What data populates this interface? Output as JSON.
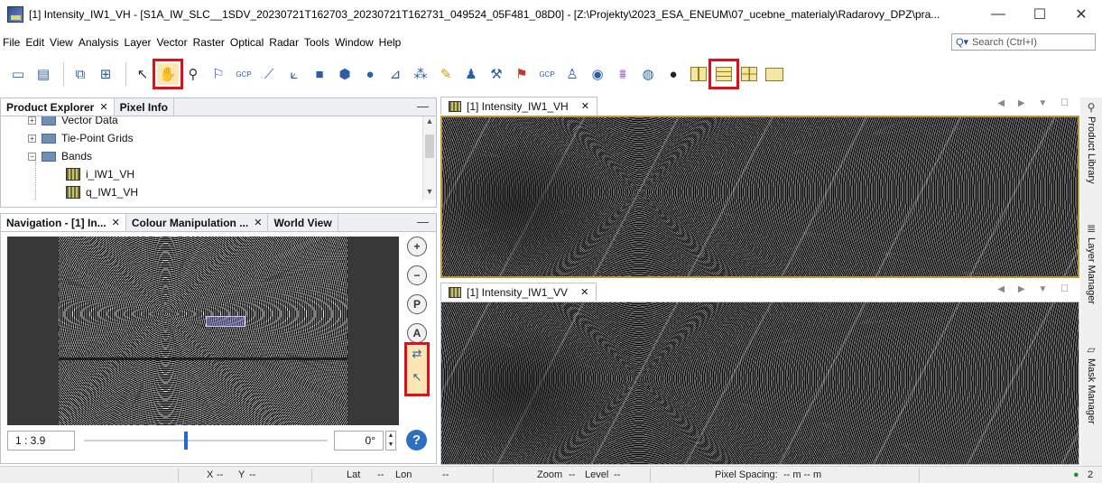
{
  "window": {
    "title": "[1] Intensity_IW1_VH - [S1A_IW_SLC__1SDV_20230721T162703_20230721T162731_049524_05F481_08D0] - [Z:\\Projekty\\2023_ESA_ENEUM\\07_ucebne_materialy\\Radarovy_DPZ\\pra...",
    "minimize": "—",
    "maximize": "☐",
    "close": "✕"
  },
  "menu": [
    "File",
    "Edit",
    "View",
    "Analysis",
    "Layer",
    "Vector",
    "Raster",
    "Optical",
    "Radar",
    "Tools",
    "Window",
    "Help"
  ],
  "search": {
    "placeholder": "Search (Ctrl+I)",
    "icon": "Q▾"
  },
  "toolbar": {
    "gcp_label": "GCP",
    "buttons": [
      "open-product-icon",
      "save-icon",
      "graph-icon",
      "batch-icon",
      "select-icon",
      "pan-icon",
      "zoom-icon",
      "pin-placing-icon",
      "gcp-placing-icon",
      "line-icon",
      "polyline-icon",
      "rectangle-icon",
      "polygon-icon",
      "ellipse-icon",
      "range-finder-icon",
      "magic-wand-icon",
      "draw-icon",
      "profile-icon",
      "statistics-icon",
      "gcp-manager-icon",
      "pin-manager-icon",
      "eye-icon",
      "spectrum-icon",
      "world-wind-icon",
      "globe-icon",
      "tile-horizontal-icon",
      "tile-vertical-icon",
      "tile-grid-icon",
      "tile-evenly-icon"
    ]
  },
  "product_explorer": {
    "tabs": [
      {
        "label": "Product Explorer",
        "close": "✕"
      },
      {
        "label": "Pixel Info"
      }
    ],
    "minimize": "—",
    "tree": [
      {
        "label": "Vector Data",
        "expander": "+"
      },
      {
        "label": "Tie-Point Grids",
        "expander": "+"
      },
      {
        "label": "Bands",
        "expander": "−"
      },
      {
        "label": "i_IW1_VH"
      },
      {
        "label": "q_IW1_VH"
      }
    ],
    "scroll_up": "▲",
    "scroll_down": "▼"
  },
  "navigation": {
    "tabs": [
      {
        "label": "Navigation - [1] In...",
        "close": "✕"
      },
      {
        "label": "Colour Manipulation ...",
        "close": "✕"
      },
      {
        "label": "World View"
      }
    ],
    "minimize": "—",
    "zoom_in": "+",
    "zoom_out": "−",
    "zoom_pixel": "P",
    "zoom_all": "A",
    "sync_views_icon": "⇄",
    "sync_cursor_icon": "↖",
    "scale": "1 : 3.9",
    "angle": "0°",
    "spin_up": "▲",
    "spin_down": "▼",
    "help": "?",
    "slider_position": 0.42
  },
  "views": [
    {
      "label": "[1] Intensity_IW1_VH",
      "close": "✕",
      "controls": "◀ ▶ ▼ ☐"
    },
    {
      "label": "[1] Intensity_IW1_VV",
      "close": "✕",
      "controls": "◀ ▶ ▼ ☐"
    }
  ],
  "right_sidebar": [
    {
      "label": "Product Library",
      "icon": "⚲"
    },
    {
      "label": "Layer Manager",
      "icon": "≣"
    },
    {
      "label": "Mask Manager",
      "icon": "▱"
    }
  ],
  "statusbar": {
    "x": "X",
    "x_val": "--",
    "y": "Y",
    "y_val": "--",
    "lat": "Lat",
    "lat_val": "--",
    "lon": "Lon",
    "lon_val": "--",
    "zoom": "Zoom",
    "zoom_val": "--",
    "level": "Level",
    "level_val": "--",
    "pixel_spacing": "Pixel Spacing:",
    "pixel_spacing_val": "-- m -- m",
    "notifications": "2"
  },
  "colors": {
    "highlight": "#e0101a",
    "view_border": "#b79a3a",
    "accent": "#1f6bd1"
  }
}
